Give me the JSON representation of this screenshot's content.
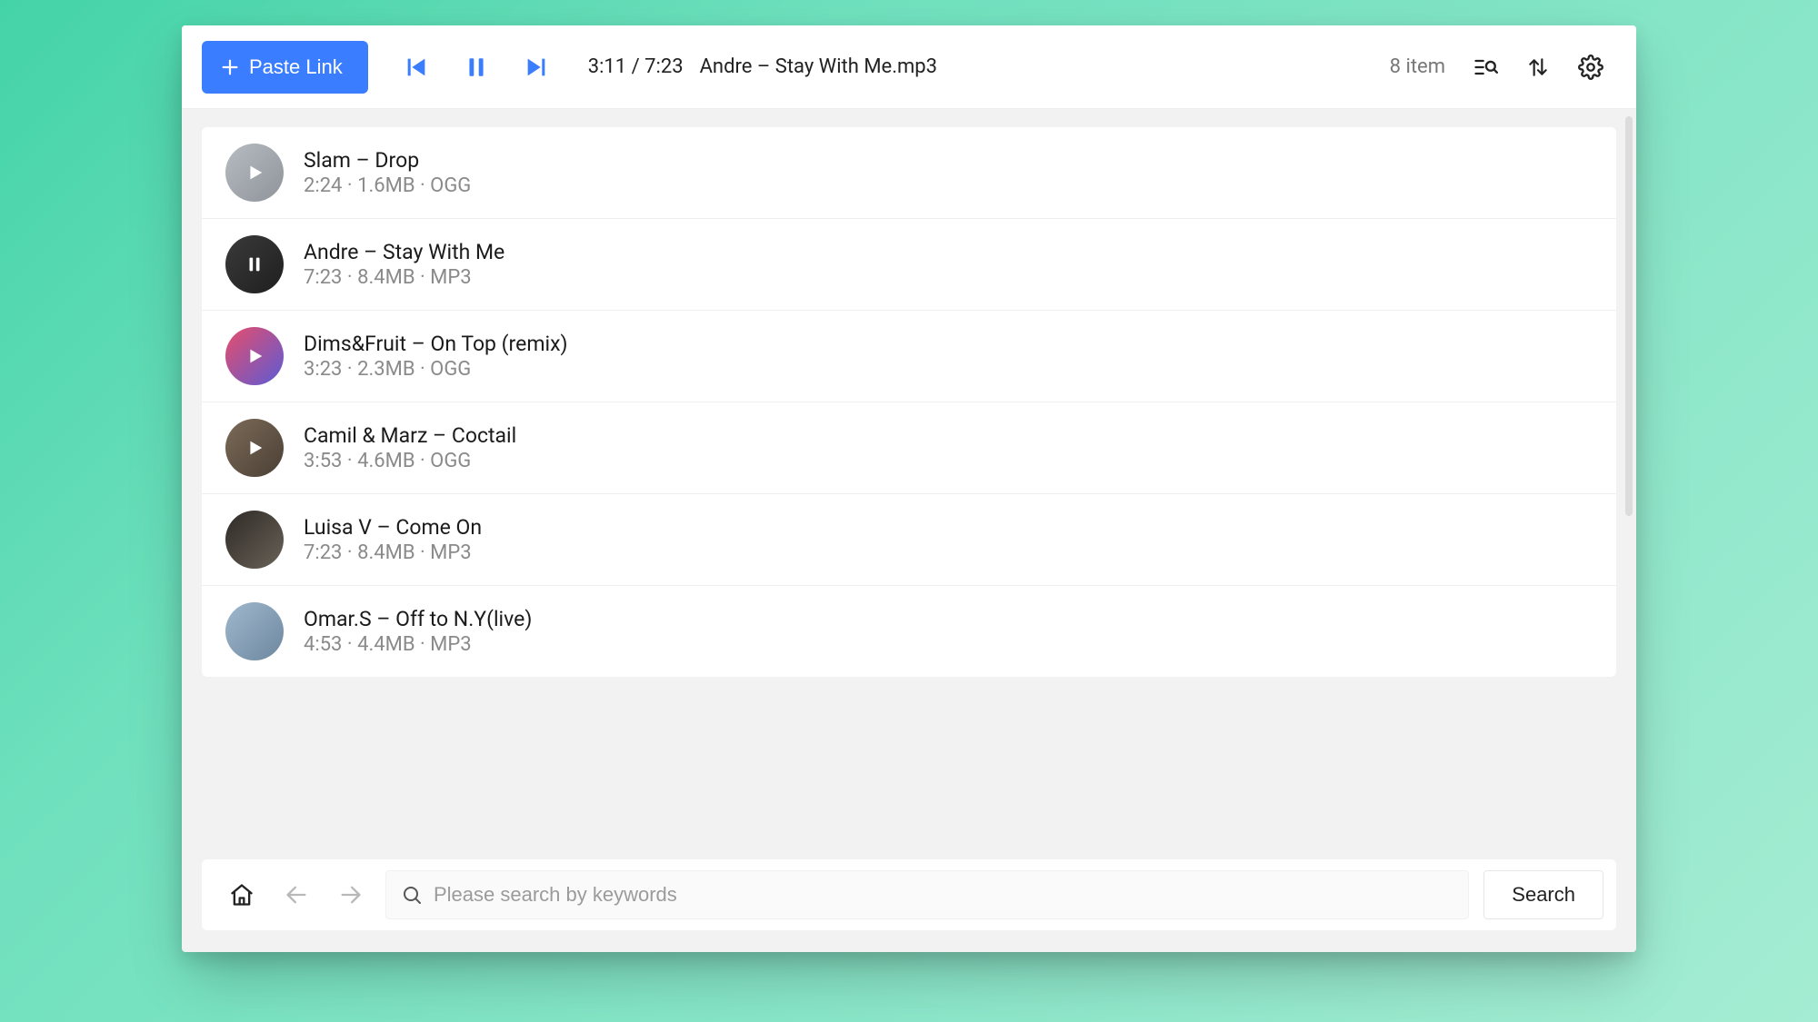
{
  "colors": {
    "accent": "#3b7dff"
  },
  "toolbar": {
    "paste_label": "Paste Link",
    "playback_time": "3:11 / 7:23",
    "now_playing": "Andre – Stay With Me.mp3",
    "item_count": "8 item"
  },
  "tracks": [
    {
      "title": "Slam – Drop",
      "meta": "2:24 · 1.6MB · OGG",
      "duration": "2:24",
      "size": "1.6MB",
      "format": "OGG",
      "state": "play",
      "thumb_bg": "linear-gradient(135deg,#b6bcc2,#8f949a)"
    },
    {
      "title": "Andre – Stay With Me",
      "meta": "7:23 · 8.4MB · MP3",
      "duration": "7:23",
      "size": "8.4MB",
      "format": "MP3",
      "state": "pause",
      "thumb_bg": "linear-gradient(135deg,#3a3a3a,#1f1f1f)"
    },
    {
      "title": "Dims&Fruit – On Top (remix)",
      "meta": "3:23 · 2.3MB · OGG",
      "duration": "3:23",
      "size": "2.3MB",
      "format": "OGG",
      "state": "play",
      "thumb_bg": "linear-gradient(135deg,#e84d6a,#5b5bd6)"
    },
    {
      "title": "Camil & Marz – Coctail",
      "meta": "3:53 · 4.6MB · OGG",
      "duration": "3:53",
      "size": "4.6MB",
      "format": "OGG",
      "state": "play",
      "thumb_bg": "linear-gradient(135deg,#7c6a57,#4a4036)"
    },
    {
      "title": "Luisa V – Come On",
      "meta": "7:23 · 8.4MB · MP3",
      "duration": "7:23",
      "size": "8.4MB",
      "format": "MP3",
      "state": "none",
      "thumb_bg": "linear-gradient(135deg,#2e2a26,#6a6258)"
    },
    {
      "title": "Omar.S – Off to N.Y(live)",
      "meta": "4:53 · 4.4MB · MP3",
      "duration": "4:53",
      "size": "4.4MB",
      "format": "MP3",
      "state": "none",
      "thumb_bg": "linear-gradient(135deg,#9fb8cc,#6d87a0)"
    }
  ],
  "search": {
    "placeholder": "Please search by keywords",
    "button_label": "Search"
  }
}
